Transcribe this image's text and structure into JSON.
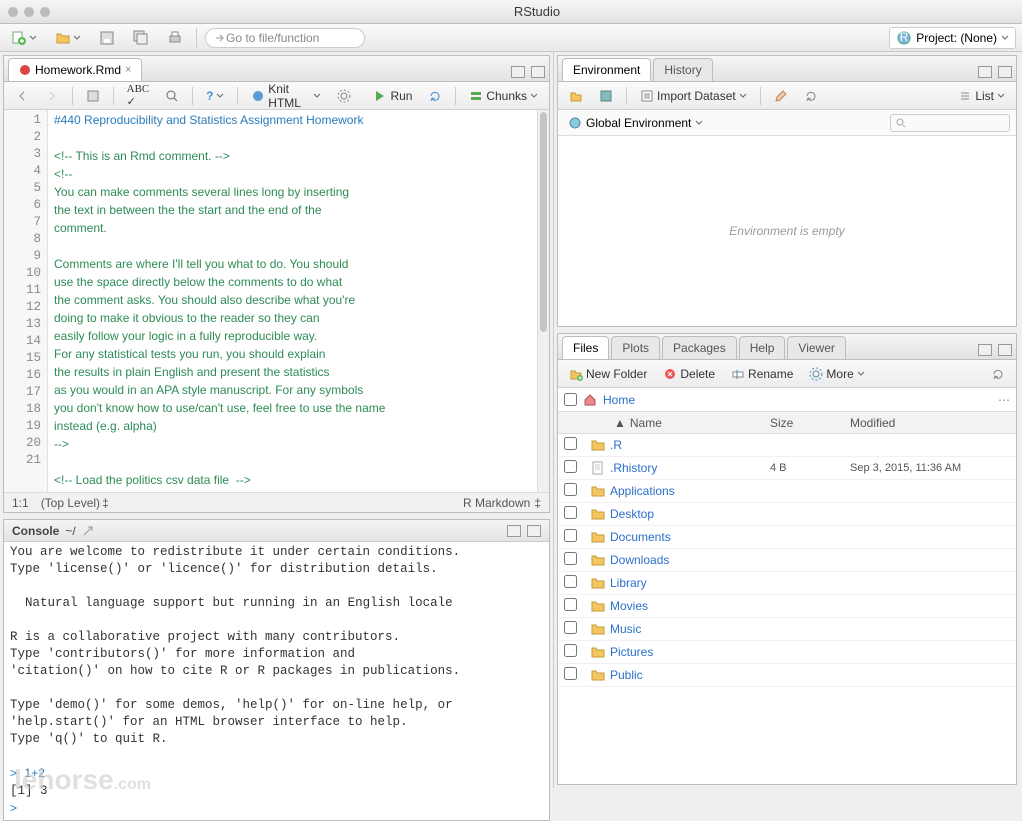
{
  "window": {
    "title": "RStudio"
  },
  "main_toolbar": {
    "goto_placeholder": "Go to file/function",
    "project_label": "Project: (None)"
  },
  "source": {
    "tab_name": "Homework.Rmd",
    "knit_label": "Knit HTML",
    "run_label": "Run",
    "chunks_label": "Chunks",
    "status_left": "1:1",
    "status_mid": "(Top Level)",
    "status_right": "R Markdown",
    "lines": [
      {
        "n": 1,
        "cls": "c-heading",
        "t": "#440 Reproducibility and Statistics Assignment Homework"
      },
      {
        "n": 2,
        "cls": "",
        "t": ""
      },
      {
        "n": 3,
        "cls": "c-comment",
        "t": "<!-- This is an Rmd comment. -->"
      },
      {
        "n": 4,
        "cls": "c-comment",
        "t": "<!--"
      },
      {
        "n": 5,
        "cls": "c-comment",
        "t": "You can make comments several lines long by inserting"
      },
      {
        "n": 6,
        "cls": "c-comment",
        "t": "the text in between the the start and the end of the"
      },
      {
        "n": 7,
        "cls": "c-comment",
        "t": "comment."
      },
      {
        "n": 8,
        "cls": "",
        "t": ""
      },
      {
        "n": 9,
        "cls": "c-comment",
        "t": "Comments are where I'll tell you what to do. You should"
      },
      {
        "n": 10,
        "cls": "c-comment",
        "t": "use the space directly below the comments to do what"
      },
      {
        "n": 11,
        "cls": "c-comment",
        "t": "the comment asks. You should also describe what you're"
      },
      {
        "n": 12,
        "cls": "c-comment",
        "t": "doing to make it obvious to the reader so they can"
      },
      {
        "n": 13,
        "cls": "c-comment",
        "t": "easily follow your logic in a fully reproducible way."
      },
      {
        "n": 14,
        "cls": "c-comment",
        "t": "For any statistical tests you run, you should explain"
      },
      {
        "n": 15,
        "cls": "c-comment",
        "t": "the results in plain English and present the statistics"
      },
      {
        "n": 16,
        "cls": "c-comment",
        "t": "as you would in an APA style manuscript. For any symbols"
      },
      {
        "n": 17,
        "cls": "c-comment",
        "t": "you don't know how to use/can't use, feel free to use the name"
      },
      {
        "n": 18,
        "cls": "c-comment",
        "t": "instead (e.g. alpha)"
      },
      {
        "n": 19,
        "cls": "c-comment",
        "t": "-->"
      },
      {
        "n": 20,
        "cls": "",
        "t": ""
      },
      {
        "n": 21,
        "cls": "c-comment",
        "t": "<!-- Load the politics csv data file  -->"
      }
    ]
  },
  "console": {
    "header": "Console",
    "path": "~/",
    "body_lines": [
      "You are welcome to redistribute it under certain conditions.",
      "Type 'license()' or 'licence()' for distribution details.",
      "",
      "  Natural language support but running in an English locale",
      "",
      "R is a collaborative project with many contributors.",
      "Type 'contributors()' for more information and",
      "'citation()' on how to cite R or R packages in publications.",
      "",
      "Type 'demo()' for some demos, 'help()' for on-line help, or",
      "'help.start()' for an HTML browser interface to help.",
      "Type 'q()' to quit R.",
      ""
    ],
    "input_prompt": ">",
    "input_history": "1+2",
    "output_line": "[1] 3"
  },
  "environment": {
    "tabs": [
      "Environment",
      "History"
    ],
    "import_label": "Import Dataset",
    "list_label": "List",
    "scope_label": "Global Environment",
    "empty_msg": "Environment is empty"
  },
  "files": {
    "tabs": [
      "Files",
      "Plots",
      "Packages",
      "Help",
      "Viewer"
    ],
    "newfolder": "New Folder",
    "delete": "Delete",
    "rename": "Rename",
    "more": "More",
    "crumb": "Home",
    "head_name": "Name",
    "head_size": "Size",
    "head_mod": "Modified",
    "rows": [
      {
        "icon": "folder",
        "name": ".R",
        "size": "",
        "mod": ""
      },
      {
        "icon": "file",
        "name": ".Rhistory",
        "size": "4 B",
        "mod": "Sep 3, 2015, 11:36 AM"
      },
      {
        "icon": "folder",
        "name": "Applications",
        "size": "",
        "mod": ""
      },
      {
        "icon": "folder",
        "name": "Desktop",
        "size": "",
        "mod": ""
      },
      {
        "icon": "folder",
        "name": "Documents",
        "size": "",
        "mod": ""
      },
      {
        "icon": "folder",
        "name": "Downloads",
        "size": "",
        "mod": ""
      },
      {
        "icon": "folder",
        "name": "Library",
        "size": "",
        "mod": ""
      },
      {
        "icon": "folder",
        "name": "Movies",
        "size": "",
        "mod": ""
      },
      {
        "icon": "folder",
        "name": "Music",
        "size": "",
        "mod": ""
      },
      {
        "icon": "folder",
        "name": "Pictures",
        "size": "",
        "mod": ""
      },
      {
        "icon": "folder",
        "name": "Public",
        "size": "",
        "mod": ""
      }
    ]
  },
  "watermark": "lehorse",
  "watermark_suffix": ".com"
}
